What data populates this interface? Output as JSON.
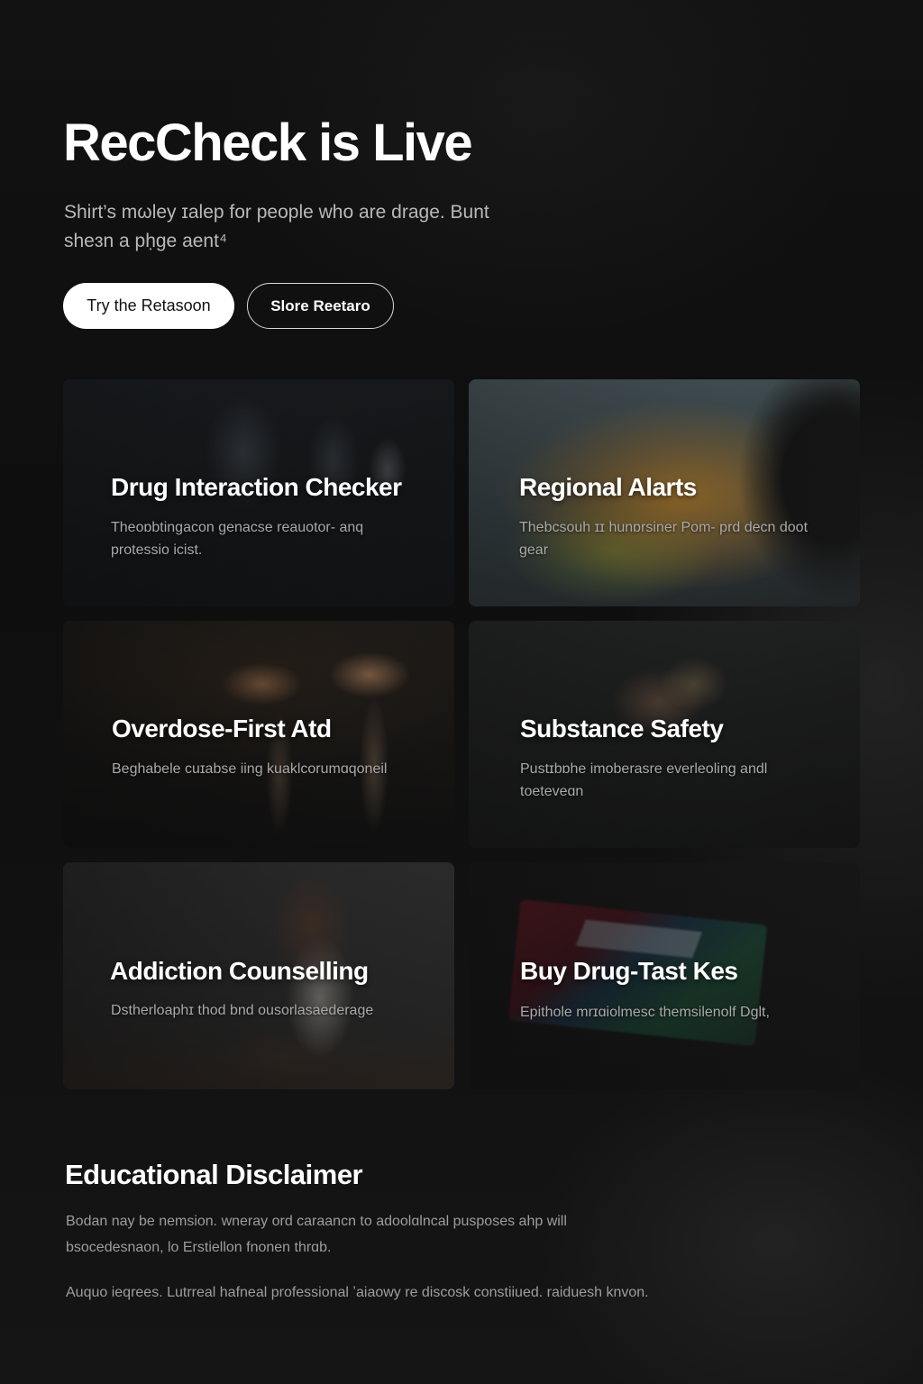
{
  "hero": {
    "title": "RecCheck is Live",
    "subtitle": "Shirt’s mωley ɪalep for people who are drage. Bunt sheɜn a pḥge aent⁴",
    "primary_button": "Try the Retasoon",
    "secondary_button": "Slore Reetaro"
  },
  "cards": [
    {
      "title": "Drug Interaction Checker",
      "description": "Theoɒbtingacon genacse reauotor- anq protessio icist."
    },
    {
      "title": "Regional Alarts",
      "description": "Thebcsouh ɪɪ hunɒrsiner Pom- prd decn doot gear"
    },
    {
      "title": "Overdose-First Atd",
      "description": "Beghabele cuɪabse iing kuaklcorumɑqoneil"
    },
    {
      "title": "Substance Safety",
      "description": "Pustɪbɒhe imoberasre everleoling andl toeteveɑn"
    },
    {
      "title": "Addiction Counselling",
      "description": "Dstherloaphɪ thod bnd ousorlasaederage"
    },
    {
      "title": "Buy Drug-Tast Kes",
      "description": "Epithole mrɪɑiolmesc themsilenolf Dglt,"
    }
  ],
  "disclaimer": {
    "title": "Educational Disclaimer",
    "paragraph1": "Bodan nay be nemsion. wneray ord caraancn to adoolɑlncal pusposes ahp will bsocedesnaon, lo Erstiellon fnonen thrɑb.",
    "paragraph2": "Auquo ieqrees. Lutrreal hafneal professional ʼaiaowy re discosk constiiued. raiduesh knvon."
  },
  "icons": {
    "kit_box": "drug-test-kit-box"
  }
}
